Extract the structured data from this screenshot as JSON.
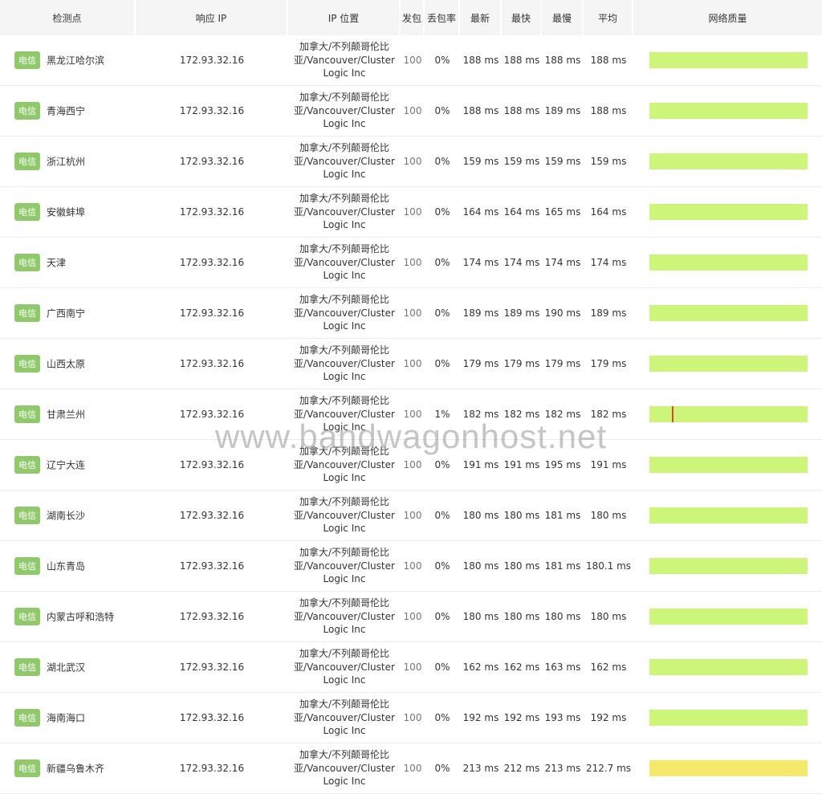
{
  "headers": {
    "node": "检测点",
    "ip": "响应 IP",
    "location": "IP 位置",
    "sent": "发包",
    "loss": "丢包率",
    "latest": "最新",
    "fastest": "最快",
    "slowest": "最慢",
    "average": "平均",
    "quality": "网络质量"
  },
  "isp_tag": "电信",
  "colors": {
    "good": "#ccf57a",
    "warn": "#f5e96b",
    "spike": "#d9492c",
    "tag": "#8fc96b"
  },
  "rows": [
    {
      "city": "黑龙江哈尔滨",
      "ip": "172.93.32.16",
      "loc1": "加拿大/不列颠哥伦比",
      "loc2": "亚/Vancouver/Cluster",
      "loc3": "Logic Inc",
      "sent": "100",
      "loss": "0%",
      "latest": "188 ms",
      "fastest": "188 ms",
      "slowest": "188 ms",
      "average": "188 ms",
      "quality": "good"
    },
    {
      "city": "青海西宁",
      "ip": "172.93.32.16",
      "loc1": "加拿大/不列颠哥伦比",
      "loc2": "亚/Vancouver/Cluster",
      "loc3": "Logic Inc",
      "sent": "100",
      "loss": "0%",
      "latest": "188 ms",
      "fastest": "188 ms",
      "slowest": "189 ms",
      "average": "188 ms",
      "quality": "good"
    },
    {
      "city": "浙江杭州",
      "ip": "172.93.32.16",
      "loc1": "加拿大/不列颠哥伦比",
      "loc2": "亚/Vancouver/Cluster",
      "loc3": "Logic Inc",
      "sent": "100",
      "loss": "0%",
      "latest": "159 ms",
      "fastest": "159 ms",
      "slowest": "159 ms",
      "average": "159 ms",
      "quality": "good"
    },
    {
      "city": "安徽蚌埠",
      "ip": "172.93.32.16",
      "loc1": "加拿大/不列颠哥伦比",
      "loc2": "亚/Vancouver/Cluster",
      "loc3": "Logic Inc",
      "sent": "100",
      "loss": "0%",
      "latest": "164 ms",
      "fastest": "164 ms",
      "slowest": "165 ms",
      "average": "164 ms",
      "quality": "good"
    },
    {
      "city": "天津",
      "ip": "172.93.32.16",
      "loc1": "加拿大/不列颠哥伦比",
      "loc2": "亚/Vancouver/Cluster",
      "loc3": "Logic Inc",
      "sent": "100",
      "loss": "0%",
      "latest": "174 ms",
      "fastest": "174 ms",
      "slowest": "174 ms",
      "average": "174 ms",
      "quality": "good"
    },
    {
      "city": "广西南宁",
      "ip": "172.93.32.16",
      "loc1": "加拿大/不列颠哥伦比",
      "loc2": "亚/Vancouver/Cluster",
      "loc3": "Logic Inc",
      "sent": "100",
      "loss": "0%",
      "latest": "189 ms",
      "fastest": "189 ms",
      "slowest": "190 ms",
      "average": "189 ms",
      "quality": "good"
    },
    {
      "city": "山西太原",
      "ip": "172.93.32.16",
      "loc1": "加拿大/不列颠哥伦比",
      "loc2": "亚/Vancouver/Cluster",
      "loc3": "Logic Inc",
      "sent": "100",
      "loss": "0%",
      "latest": "179 ms",
      "fastest": "179 ms",
      "slowest": "179 ms",
      "average": "179 ms",
      "quality": "good"
    },
    {
      "city": "甘肃兰州",
      "ip": "172.93.32.16",
      "loc1": "加拿大/不列颠哥伦比",
      "loc2": "亚/Vancouver/Cluster",
      "loc3": "Logic Inc",
      "sent": "100",
      "loss": "1%",
      "latest": "182 ms",
      "fastest": "182 ms",
      "slowest": "182 ms",
      "average": "182 ms",
      "quality": "good",
      "loss_mark": 0.14
    },
    {
      "city": "辽宁大连",
      "ip": "172.93.32.16",
      "loc1": "加拿大/不列颠哥伦比",
      "loc2": "亚/Vancouver/Cluster",
      "loc3": "Logic Inc",
      "sent": "100",
      "loss": "0%",
      "latest": "191 ms",
      "fastest": "191 ms",
      "slowest": "195 ms",
      "average": "191 ms",
      "quality": "good"
    },
    {
      "city": "湖南长沙",
      "ip": "172.93.32.16",
      "loc1": "加拿大/不列颠哥伦比",
      "loc2": "亚/Vancouver/Cluster",
      "loc3": "Logic Inc",
      "sent": "100",
      "loss": "0%",
      "latest": "180 ms",
      "fastest": "180 ms",
      "slowest": "181 ms",
      "average": "180 ms",
      "quality": "good"
    },
    {
      "city": "山东青岛",
      "ip": "172.93.32.16",
      "loc1": "加拿大/不列颠哥伦比",
      "loc2": "亚/Vancouver/Cluster",
      "loc3": "Logic Inc",
      "sent": "100",
      "loss": "0%",
      "latest": "180 ms",
      "fastest": "180 ms",
      "slowest": "181 ms",
      "average": "180.1 ms",
      "quality": "good"
    },
    {
      "city": "内蒙古呼和浩特",
      "ip": "172.93.32.16",
      "loc1": "加拿大/不列颠哥伦比",
      "loc2": "亚/Vancouver/Cluster",
      "loc3": "Logic Inc",
      "sent": "100",
      "loss": "0%",
      "latest": "180 ms",
      "fastest": "180 ms",
      "slowest": "180 ms",
      "average": "180 ms",
      "quality": "good"
    },
    {
      "city": "湖北武汉",
      "ip": "172.93.32.16",
      "loc1": "加拿大/不列颠哥伦比",
      "loc2": "亚/Vancouver/Cluster",
      "loc3": "Logic Inc",
      "sent": "100",
      "loss": "0%",
      "latest": "162 ms",
      "fastest": "162 ms",
      "slowest": "163 ms",
      "average": "162 ms",
      "quality": "good"
    },
    {
      "city": "海南海口",
      "ip": "172.93.32.16",
      "loc1": "加拿大/不列颠哥伦比",
      "loc2": "亚/Vancouver/Cluster",
      "loc3": "Logic Inc",
      "sent": "100",
      "loss": "0%",
      "latest": "192 ms",
      "fastest": "192 ms",
      "slowest": "193 ms",
      "average": "192 ms",
      "quality": "good"
    },
    {
      "city": "新疆乌鲁木齐",
      "ip": "172.93.32.16",
      "loc1": "加拿大/不列颠哥伦比",
      "loc2": "亚/Vancouver/Cluster",
      "loc3": "Logic Inc",
      "sent": "100",
      "loss": "0%",
      "latest": "213 ms",
      "fastest": "212 ms",
      "slowest": "213 ms",
      "average": "212.7 ms",
      "quality": "warn"
    }
  ],
  "watermark": "www.bandwagonhost.net"
}
